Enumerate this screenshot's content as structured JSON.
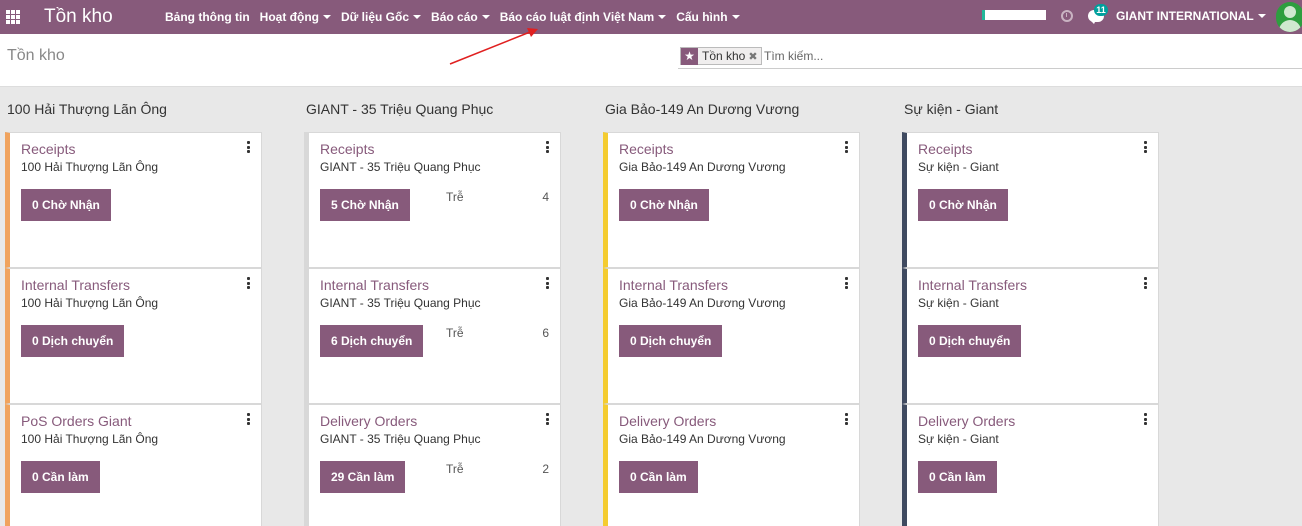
{
  "navbar": {
    "app_name": "Tồn kho",
    "menu": [
      {
        "label": "Bảng thông tin",
        "dropdown": false
      },
      {
        "label": "Hoạt động",
        "dropdown": true
      },
      {
        "label": "Dữ liệu Gốc",
        "dropdown": true
      },
      {
        "label": "Báo cáo",
        "dropdown": true
      },
      {
        "label": "Báo cáo luật định Việt Nam",
        "dropdown": true
      },
      {
        "label": "Cấu hình",
        "dropdown": true
      }
    ],
    "progress_fraction": 0.05,
    "chat_badge": "11",
    "company": "GIANT INTERNATIONAL",
    "accent_color": "#875a7b"
  },
  "control_panel": {
    "title": "Tồn kho",
    "facet": "Tồn kho",
    "search_placeholder": "Tìm kiếm..."
  },
  "columns": [
    {
      "title": "100 Hải Thượng Lãn Ông",
      "color": "#f0a35e",
      "cards": [
        {
          "name": "Receipts",
          "warehouse": "100 Hải Thượng Lãn Ông",
          "button": "0 Chờ Nhận",
          "late_label": "",
          "late_count": ""
        },
        {
          "name": "Internal Transfers",
          "warehouse": "100 Hải Thượng Lãn Ông",
          "button": "0 Dịch chuyển",
          "late_label": "",
          "late_count": ""
        },
        {
          "name": "PoS Orders Giant",
          "warehouse": "100 Hải Thượng Lãn Ông",
          "button": "0 Cần làm",
          "late_label": "",
          "late_count": ""
        }
      ]
    },
    {
      "title": "GIANT - 35 Triệu Quang Phục",
      "color": "#d8d8d8",
      "cards": [
        {
          "name": "Receipts",
          "warehouse": "GIANT - 35 Triệu Quang Phục",
          "button": "5 Chờ Nhận",
          "late_label": "Trễ",
          "late_count": "4"
        },
        {
          "name": "Internal Transfers",
          "warehouse": "GIANT - 35 Triệu Quang Phục",
          "button": "6 Dịch chuyển",
          "late_label": "Trễ",
          "late_count": "6"
        },
        {
          "name": "Delivery Orders",
          "warehouse": "GIANT - 35 Triệu Quang Phục",
          "button": "29 Cần làm",
          "late_label": "Trễ",
          "late_count": "2"
        }
      ]
    },
    {
      "title": "Gia Bảo-149 An Dương Vương",
      "color": "#f4cc30",
      "cards": [
        {
          "name": "Receipts",
          "warehouse": "Gia Bảo-149 An Dương Vương",
          "button": "0 Chờ Nhận",
          "late_label": "",
          "late_count": ""
        },
        {
          "name": "Internal Transfers",
          "warehouse": "Gia Bảo-149 An Dương Vương",
          "button": "0 Dịch chuyển",
          "late_label": "",
          "late_count": ""
        },
        {
          "name": "Delivery Orders",
          "warehouse": "Gia Bảo-149 An Dương Vương",
          "button": "0 Cần làm",
          "late_label": "",
          "late_count": ""
        }
      ]
    },
    {
      "title": "Sự kiện - Giant",
      "color": "#3f4a60",
      "cards": [
        {
          "name": "Receipts",
          "warehouse": "Sự kiện - Giant",
          "button": "0 Chờ Nhận",
          "late_label": "",
          "late_count": ""
        },
        {
          "name": "Internal Transfers",
          "warehouse": "Sự kiện - Giant",
          "button": "0 Dịch chuyển",
          "late_label": "",
          "late_count": ""
        },
        {
          "name": "Delivery Orders",
          "warehouse": "Sự kiện - Giant",
          "button": "0 Cần làm",
          "late_label": "",
          "late_count": ""
        }
      ]
    }
  ]
}
